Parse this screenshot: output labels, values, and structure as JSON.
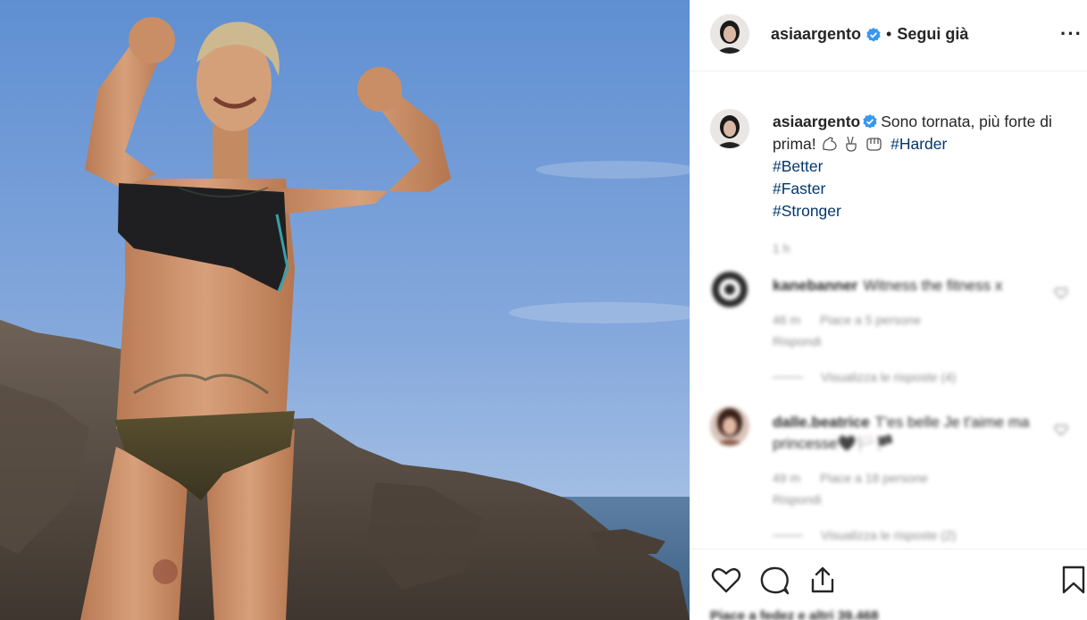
{
  "post": {
    "author": "asiaargento",
    "follow_state": "Segui già",
    "more_label": "···"
  },
  "caption": {
    "username": "asiaargento",
    "text": "Sono tornata, più forte di prima!",
    "hashtags": [
      "#Harder",
      "#Better",
      "#Faster",
      "#Stronger"
    ],
    "time": "1 h"
  },
  "comments": [
    {
      "username": "kanebanner",
      "text": "Witness the fitness x",
      "time": "46 m",
      "likes": "Piace a 5 persone",
      "reply": "Rispondi",
      "view_replies": "Visualizza le risposte (4)"
    },
    {
      "username": "dalle.beatrice",
      "text": "T'es belle Je t'aime ma princesse🖤🏳️🏴",
      "time": "49 m",
      "likes": "Piace a 18 persone",
      "reply": "Rispondi",
      "view_replies": "Visualizza le risposte (2)"
    }
  ],
  "footer": {
    "likes_text": "Piace a fedez e altri 39.468"
  },
  "colors": {
    "verified": "#3897f0",
    "hashtag": "#00376b",
    "muted": "#8e8e8e"
  },
  "icons": [
    "verified-badge-icon",
    "more-options-icon",
    "heart-icon",
    "comment-icon",
    "share-icon",
    "bookmark-icon"
  ]
}
